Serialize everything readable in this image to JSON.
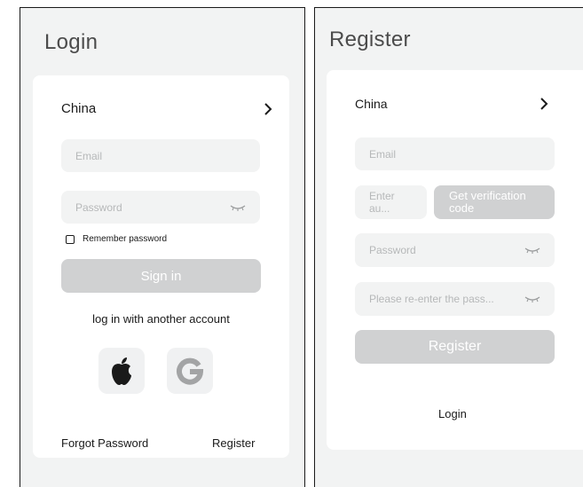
{
  "login": {
    "title": "Login",
    "country": "China",
    "email_placeholder": "Email",
    "password_placeholder": "Password",
    "remember_label": "Remember password",
    "sign_in_label": "Sign in",
    "alt_login_text": "log in with another account",
    "social_icons": [
      "apple-icon",
      "google-icon"
    ],
    "forgot_password_label": "Forgot Password",
    "register_link_label": "Register"
  },
  "register": {
    "title": "Register",
    "country": "China",
    "email_placeholder": "Email",
    "code_placeholder": "Enter au...",
    "get_code_label": "Get verification code",
    "password_placeholder": "Password",
    "confirm_password_placeholder": "Please re-enter the pass...",
    "register_button_label": "Register",
    "login_link_label": "Login"
  },
  "colors": {
    "background": "#f2f3f3",
    "card": "#ffffff",
    "button_disabled": "#d0d1d2",
    "placeholder": "#b6b8b9"
  }
}
